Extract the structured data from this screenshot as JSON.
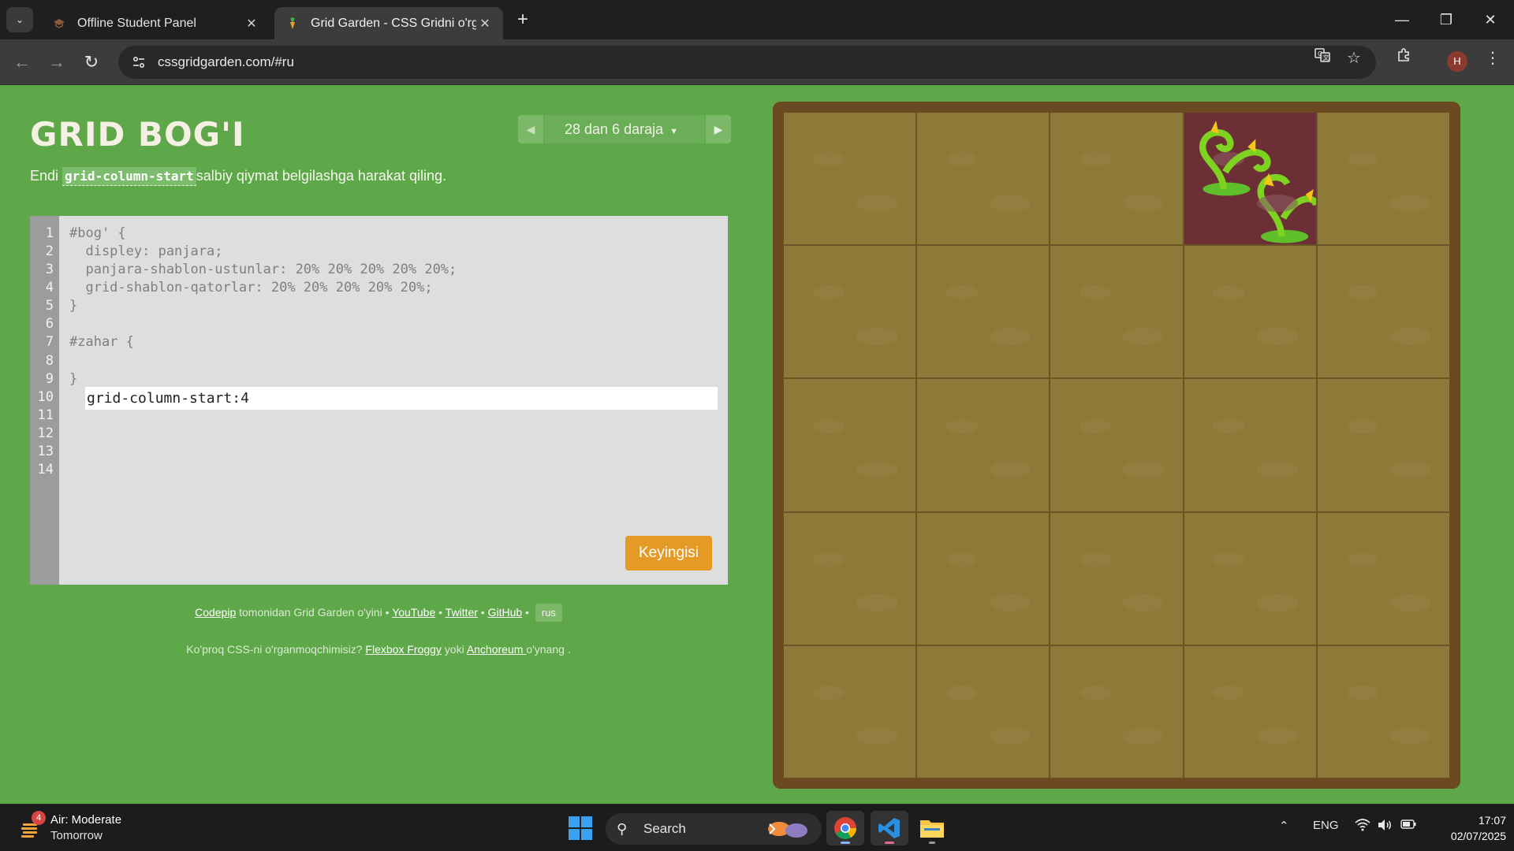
{
  "browser": {
    "tabs": [
      {
        "title": "Offline Student Panel",
        "active": false
      },
      {
        "title": "Grid Garden - CSS Gridni o'rganish",
        "active": true
      }
    ],
    "url": "cssgridgarden.com/#ru",
    "profile_initial": "H"
  },
  "game": {
    "title": "GRID BOG'I",
    "level_text": "28 dan 6  daraja",
    "instruction_prefix": "Endi ",
    "instruction_code": "grid-column-start",
    "instruction_suffix": "salbiy qiymat belgilashga harakat qiling.",
    "line_numbers": [
      "1",
      "2",
      "3",
      "4",
      "5",
      "6",
      "7",
      "8",
      "9",
      "10",
      "11",
      "12",
      "13",
      "14"
    ],
    "code_lines": [
      "#bog' {",
      "  displey: panjara;",
      "  panjara-shablon-ustunlar: 20% 20% 20% 20% 20%;",
      "  grid-shablon-qatorlar: 20% 20% 20% 20% 20%;",
      "}",
      "",
      "#zahar {",
      "",
      "}"
    ],
    "input_value": "grid-column-start:4",
    "next_label": "Keyingisi",
    "poison_column": 4,
    "grid_columns": 5,
    "grid_rows": 5
  },
  "footer": {
    "author_link": "Codepip",
    "credit_text": " tomonidan Grid Garden o'yini • ",
    "youtube": "YouTube",
    "twitter": "Twitter",
    "github": "GitHub",
    "sep": " • ",
    "lang": "rus",
    "more_prefix": "Ko'proq CSS-ni o'rganmoqchimisiz? ",
    "froggy": "Flexbox Froggy",
    "or": " yoki ",
    "anchoreum": "Anchoreum ",
    "more_suffix": "o'ynang ."
  },
  "taskbar": {
    "weather_badge": "4",
    "weather_title": "Air: Moderate",
    "weather_sub": "Tomorrow",
    "search_label": "Search",
    "language": "ENG",
    "time": "17:07",
    "date": "02/07/2025"
  },
  "colors": {
    "page_bg": "#5ea84a",
    "soil": "#8e7a38",
    "poison": "#6b2f35",
    "button": "#e59a26"
  }
}
